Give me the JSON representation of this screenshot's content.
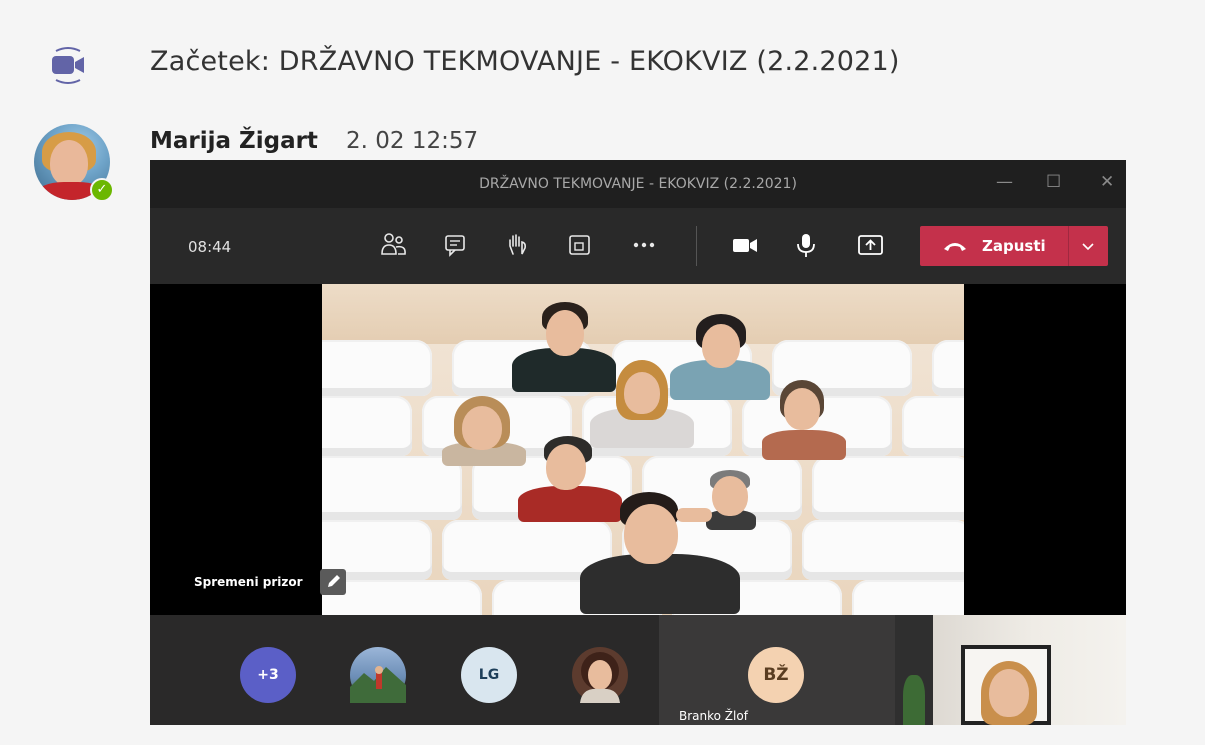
{
  "post": {
    "meeting_title": "Začetek: DRŽAVNO TEKMOVANJE - EKOKVIZ (2.2.2021)",
    "meeting_icon": "video-camera-icon",
    "author": "Marija Žigart",
    "timestamp": "2. 02 12:57",
    "presence": "available"
  },
  "call_window": {
    "title": "DRŽAVNO TEKMOVANJE - EKOKVIZ (2.2.2021)",
    "controls": [
      "minimize-icon",
      "maximize-icon",
      "close-icon"
    ],
    "toolbar": {
      "timer": "08:44",
      "buttons": [
        "participants-icon",
        "chat-icon",
        "raise-hand-icon",
        "rooms-icon",
        "more-icon",
        "camera-icon",
        "microphone-icon",
        "share-icon"
      ],
      "leave_label": "Zapusti",
      "leave_color": "#c4314b"
    },
    "stage": {
      "view": "Together mode",
      "change_scene_label": "Spremeni prizor"
    },
    "participants": [
      {
        "label": "+3",
        "color": "#5b5fc7"
      },
      {
        "label": "",
        "kind": "photo"
      },
      {
        "label": "LG",
        "color": "#d9e6ef"
      },
      {
        "label": "",
        "kind": "photo"
      }
    ],
    "featured": {
      "initials": "BŽ",
      "name": "Branko Žlof"
    }
  }
}
